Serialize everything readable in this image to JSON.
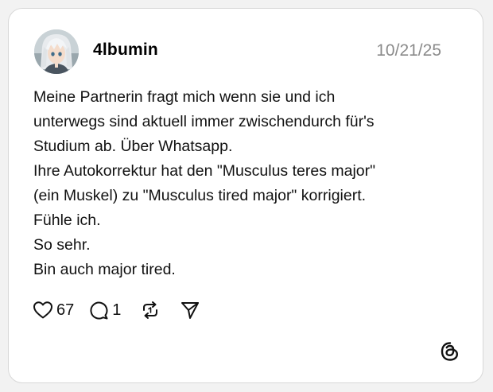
{
  "post": {
    "username": "4lbumin",
    "timestamp": "10/21/25",
    "lines": [
      "Meine Partnerin fragt mich wenn sie und ich",
      "unterwegs sind aktuell immer zwischendurch für's",
      "Studium ab. Über Whatsapp.",
      "Ihre Autokorrektur hat den \"Musculus teres major\"",
      "(ein Muskel) zu \"Musculus tired major\" korrigiert.",
      "Fühle ich.",
      "So sehr.",
      "Bin auch major tired."
    ]
  },
  "actions": {
    "like_icon": "heart-icon",
    "like_count": "67",
    "reply_icon": "comment-icon",
    "reply_count": "1",
    "repost_icon": "repost-icon",
    "share_icon": "send-icon"
  },
  "branding": {
    "logo_icon": "threads-logo-icon"
  },
  "colors": {
    "background": "#f2f2f2",
    "card": "#ffffff",
    "text": "#111111",
    "muted": "#8a8a8a",
    "border": "#d8d8d8"
  }
}
